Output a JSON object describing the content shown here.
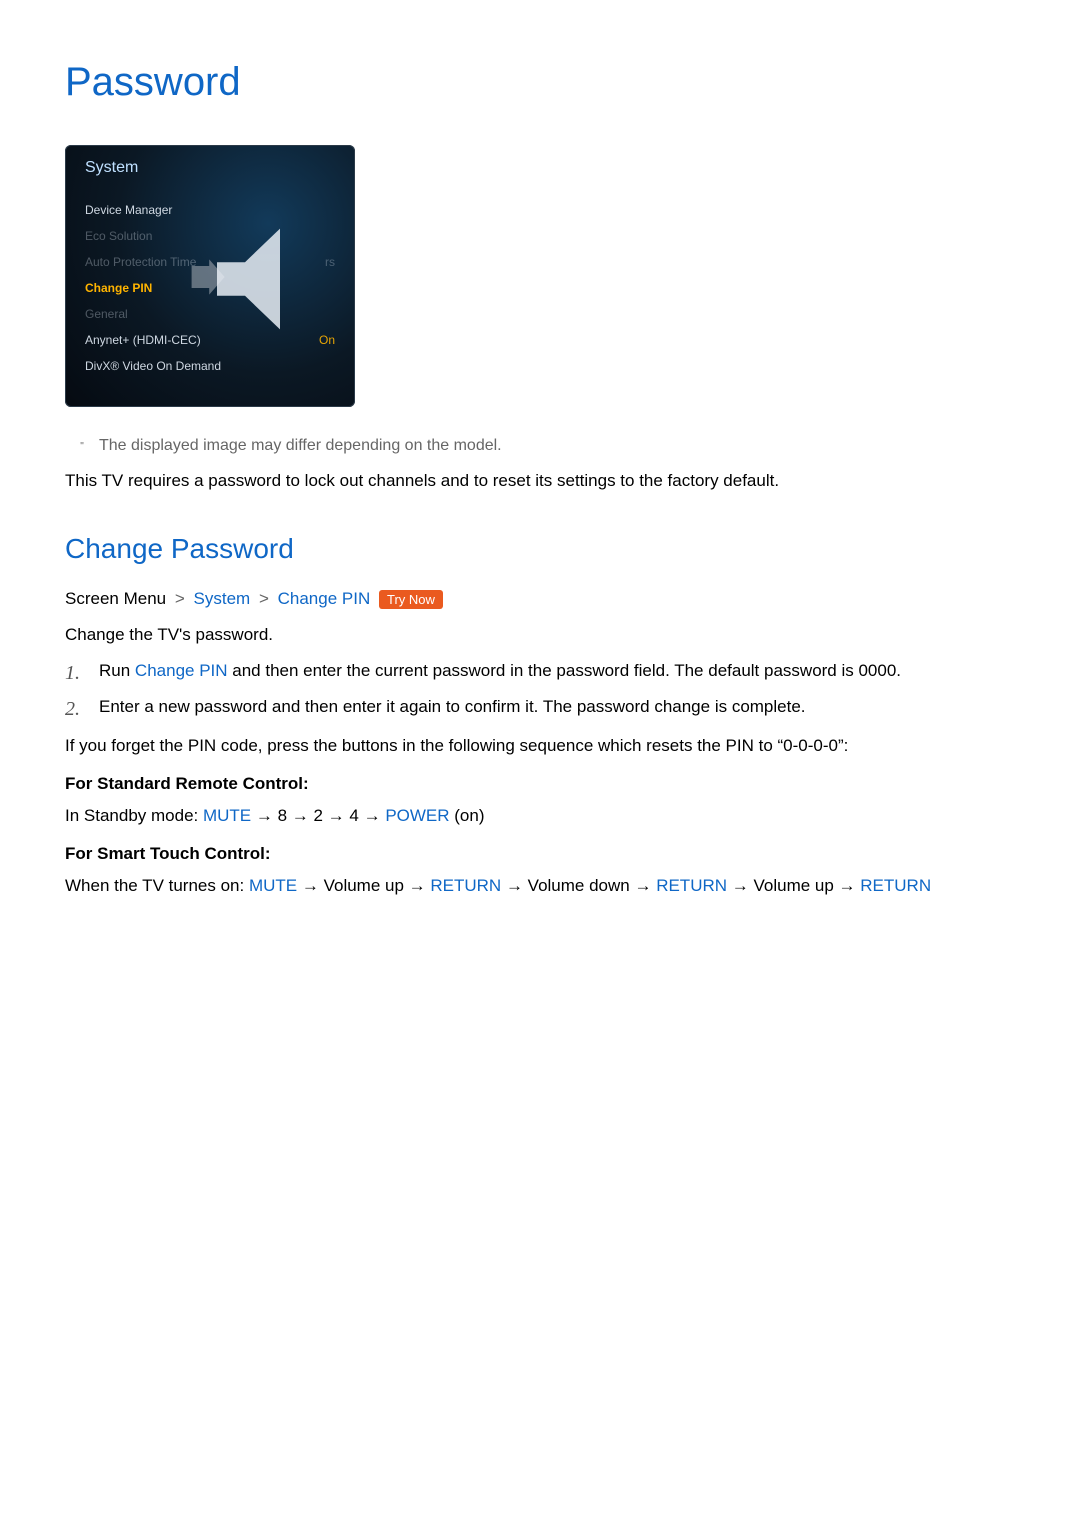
{
  "heading": "Password",
  "tv": {
    "title": "System",
    "items": [
      {
        "label": "Device Manager",
        "value": "",
        "fade": false,
        "sel": false
      },
      {
        "label": "Eco Solution",
        "value": "",
        "fade": true,
        "sel": false
      },
      {
        "label": "Auto Protection Time",
        "value": "rs",
        "fade": true,
        "sel": false
      },
      {
        "label": "Change PIN",
        "value": "",
        "fade": false,
        "sel": true
      },
      {
        "label": "General",
        "value": "",
        "fade": true,
        "sel": false
      },
      {
        "label": "Anynet+ (HDMI-CEC)",
        "value": "On",
        "fade": false,
        "sel": false
      },
      {
        "label": "DivX® Video On Demand",
        "value": "",
        "fade": false,
        "sel": false
      }
    ]
  },
  "note": "The displayed image may differ depending on the model.",
  "intro": "This TV requires a password to lock out channels and to reset its settings to the factory default.",
  "section2": "Change Password",
  "path": {
    "prefix": "Screen Menu",
    "seg1": "System",
    "seg2": "Change PIN",
    "try": "Try Now"
  },
  "change_line": "Change the TV's password.",
  "step1_a": "Run ",
  "step1_kw": "Change PIN",
  "step1_b": " and then enter the current password in the password field. The default password is 0000.",
  "step2": "Enter a new password and then enter it again to confirm it. The password change is complete.",
  "forget": "If you forget the PIN code, press the buttons in the following sequence which resets the PIN to “0-0-0-0”:",
  "std_label": "For Standard Remote Control:",
  "std_a": "In Standby mode: ",
  "kw_mute": "MUTE",
  "kw_power": "POWER",
  "kw_return": "RETURN",
  "std_seq": [
    " → 8 → 2 → 4 → ",
    " (on)"
  ],
  "smart_label": "For Smart Touch Control:",
  "smart_a": "When the TV turnes on: ",
  "smart_parts": {
    "vu": " → Volume up → ",
    "vd": " → Volume down → ",
    "vu2": " → Volume up → "
  },
  "num1": "1.",
  "num2": "2.",
  "note_mark": "\""
}
